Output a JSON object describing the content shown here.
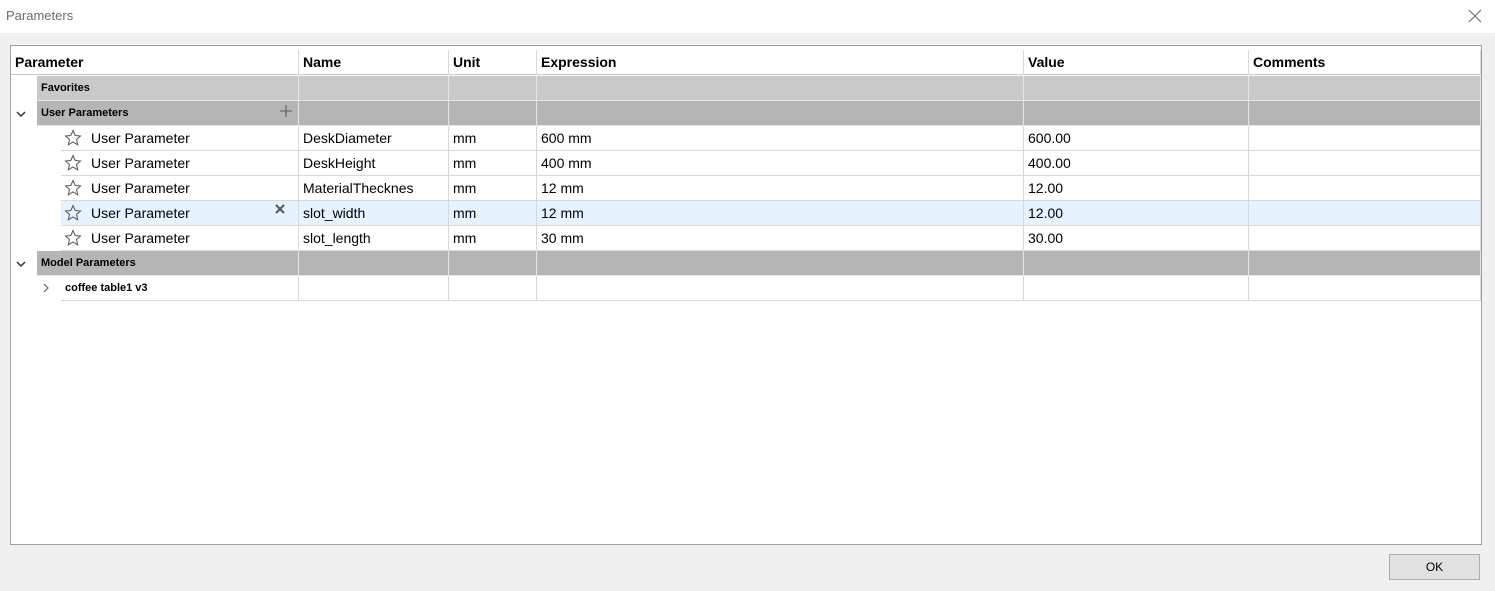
{
  "window": {
    "title": "Parameters"
  },
  "table": {
    "columns": [
      "Parameter",
      "Name",
      "Unit",
      "Expression",
      "Value",
      "Comments"
    ],
    "groups": {
      "favorites": {
        "label": "Favorites"
      },
      "user": {
        "label": "User Parameters"
      },
      "model": {
        "label": "Model Parameters"
      }
    },
    "user_rows": [
      {
        "parameter": "User Parameter",
        "name": "DeskDiameter",
        "unit": "mm",
        "expression": "600 mm",
        "value": "600.00",
        "comments": ""
      },
      {
        "parameter": "User Parameter",
        "name": "DeskHeight",
        "unit": "mm",
        "expression": "400 mm",
        "value": "400.00",
        "comments": ""
      },
      {
        "parameter": "User Parameter",
        "name": "MaterialThecknes",
        "unit": "mm",
        "expression": "12 mm",
        "value": "12.00",
        "comments": ""
      },
      {
        "parameter": "User Parameter",
        "name": "slot_width",
        "unit": "mm",
        "expression": "12 mm",
        "value": "12.00",
        "comments": ""
      },
      {
        "parameter": "User Parameter",
        "name": "slot_length",
        "unit": "mm",
        "expression": "30 mm",
        "value": "30.00",
        "comments": ""
      }
    ],
    "model_rows": [
      {
        "label": "coffee table1 v3"
      }
    ]
  },
  "buttons": {
    "ok": "OK"
  },
  "icons": [
    "close-icon",
    "chevron-down-icon",
    "chevron-right-icon",
    "star-icon",
    "plus-icon",
    "delete-x-icon"
  ],
  "colors": {
    "group_bg": "#c9c9c9",
    "group_dark_bg": "#b5b5b5",
    "selected_row": "#e5f3ff"
  }
}
